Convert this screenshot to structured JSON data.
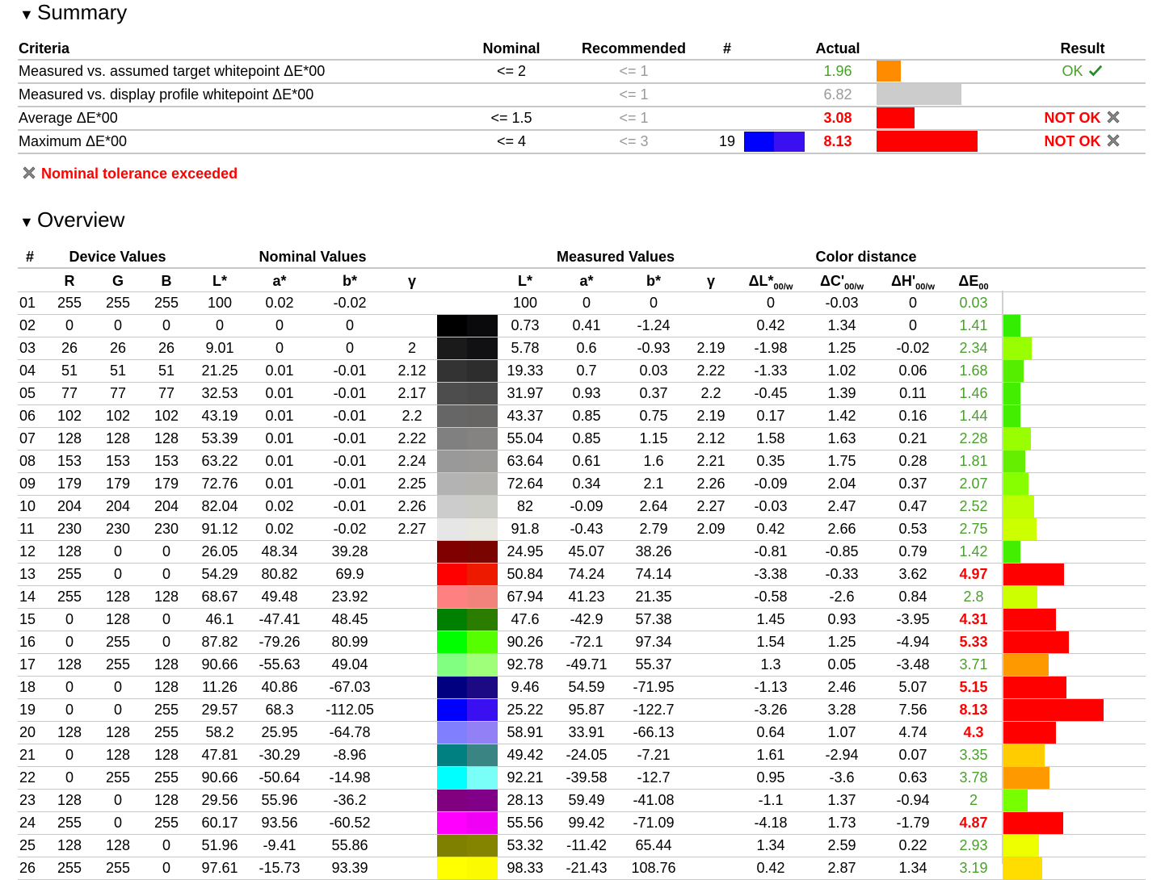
{
  "summary": {
    "heading": "Summary",
    "headers": {
      "criteria": "Criteria",
      "nominal": "Nominal",
      "recommended": "Recommended",
      "count": "#",
      "actual": "Actual",
      "result": "Result"
    },
    "rows": [
      {
        "criteria": "Measured vs. assumed target whitepoint ΔE*00",
        "nominal": "<= 2",
        "recommended": "<= 1",
        "count": "",
        "actual": "1.96",
        "actual_color": "#4aa02c",
        "actual_bold": false,
        "bar_color": "#ff8c00",
        "bar_value": 1.96,
        "result": "OK",
        "result_type": "ok"
      },
      {
        "criteria": "Measured vs. display profile whitepoint ΔE*00",
        "nominal": "",
        "recommended": "<= 1",
        "count": "",
        "actual": "6.82",
        "actual_color": "#9a9a9a",
        "actual_bold": false,
        "bar_color": "#cccccc",
        "bar_value": 6.82,
        "result": "",
        "result_type": "none"
      },
      {
        "criteria": "Average ΔE*00",
        "nominal": "<= 1.5",
        "recommended": "<= 1",
        "count": "",
        "actual": "3.08",
        "actual_color": "#ff0000",
        "actual_bold": true,
        "bar_color": "#ff0000",
        "bar_value": 3.08,
        "result": "NOT OK",
        "result_type": "fail"
      },
      {
        "criteria": "Maximum ΔE*00",
        "nominal": "<= 4",
        "recommended": "<= 3",
        "count": "19",
        "swatch": [
          "#0000ff",
          "#3a10f0"
        ],
        "actual": "8.13",
        "actual_color": "#ff0000",
        "actual_bold": true,
        "bar_color": "#ff0000",
        "bar_value": 8.13,
        "result": "NOT OK",
        "result_type": "fail"
      }
    ],
    "tolerance_note": "Nominal tolerance exceeded"
  },
  "overview": {
    "heading": "Overview",
    "groups": {
      "num": "#",
      "device": "Device Values",
      "nominal": "Nominal Values",
      "measured": "Measured Values",
      "distance": "Color distance"
    },
    "columns": {
      "r": "R",
      "g": "G",
      "b": "B",
      "L": "L*",
      "a": "a*",
      "bb": "b*",
      "gamma": "γ",
      "mL": "L*",
      "ma": "a*",
      "mb": "b*",
      "mgamma": "γ",
      "dL": "ΔL*",
      "dL_sub": "00/w",
      "dC": "ΔC'",
      "dC_sub": "00/w",
      "dH": "ΔH'",
      "dH_sub": "00/w",
      "dE": "ΔE",
      "dE_sub": "00"
    },
    "rows": [
      {
        "n": "01",
        "r": "255",
        "g": "255",
        "b": "255",
        "L": "100",
        "a": "0.02",
        "bb": "-0.02",
        "gm": "",
        "mL": "100",
        "ma": "0",
        "mb": "0",
        "mgm": "",
        "dL": "0",
        "dC": "-0.03",
        "dH": "0",
        "dE": "0.03",
        "sw": [
          "#ffffff",
          "#ffffff"
        ],
        "bar": "#33cc00"
      },
      {
        "n": "02",
        "r": "0",
        "g": "0",
        "b": "0",
        "L": "0",
        "a": "0",
        "bb": "0",
        "gm": "",
        "mL": "0.73",
        "ma": "0.41",
        "mb": "-1.24",
        "mgm": "",
        "dL": "0.42",
        "dC": "1.34",
        "dH": "0",
        "dE": "1.41",
        "sw": [
          "#000000",
          "#0a0a0c"
        ],
        "bar": "#33ee00"
      },
      {
        "n": "03",
        "r": "26",
        "g": "26",
        "b": "26",
        "L": "9.01",
        "a": "0",
        "bb": "0",
        "gm": "2",
        "mL": "5.78",
        "ma": "0.6",
        "mb": "-0.93",
        "mgm": "2.19",
        "dL": "-1.98",
        "dC": "1.25",
        "dH": "-0.02",
        "dE": "2.34",
        "sw": [
          "#1a1a1a",
          "#111113"
        ],
        "bar": "#99ff00"
      },
      {
        "n": "04",
        "r": "51",
        "g": "51",
        "b": "51",
        "L": "21.25",
        "a": "0.01",
        "bb": "-0.01",
        "gm": "2.12",
        "mL": "19.33",
        "ma": "0.7",
        "mb": "0.03",
        "mgm": "2.22",
        "dL": "-1.33",
        "dC": "1.02",
        "dH": "0.06",
        "dE": "1.68",
        "sw": [
          "#333333",
          "#2e2d2e"
        ],
        "bar": "#55ee00"
      },
      {
        "n": "05",
        "r": "77",
        "g": "77",
        "b": "77",
        "L": "32.53",
        "a": "0.01",
        "bb": "-0.01",
        "gm": "2.17",
        "mL": "31.97",
        "ma": "0.93",
        "mb": "0.37",
        "mgm": "2.2",
        "dL": "-0.45",
        "dC": "1.39",
        "dH": "0.11",
        "dE": "1.46",
        "sw": [
          "#4d4d4d",
          "#4b4a4a"
        ],
        "bar": "#44ee00"
      },
      {
        "n": "06",
        "r": "102",
        "g": "102",
        "b": "102",
        "L": "43.19",
        "a": "0.01",
        "bb": "-0.01",
        "gm": "2.2",
        "mL": "43.37",
        "ma": "0.85",
        "mb": "0.75",
        "mgm": "2.19",
        "dL": "0.17",
        "dC": "1.42",
        "dH": "0.16",
        "dE": "1.44",
        "sw": [
          "#666666",
          "#666564"
        ],
        "bar": "#44ee00"
      },
      {
        "n": "07",
        "r": "128",
        "g": "128",
        "b": "128",
        "L": "53.39",
        "a": "0.01",
        "bb": "-0.01",
        "gm": "2.22",
        "mL": "55.04",
        "ma": "0.85",
        "mb": "1.15",
        "mgm": "2.12",
        "dL": "1.58",
        "dC": "1.63",
        "dH": "0.21",
        "dE": "2.28",
        "sw": [
          "#808080",
          "#858382"
        ],
        "bar": "#99ff00"
      },
      {
        "n": "08",
        "r": "153",
        "g": "153",
        "b": "153",
        "L": "63.22",
        "a": "0.01",
        "bb": "-0.01",
        "gm": "2.24",
        "mL": "63.64",
        "ma": "0.61",
        "mb": "1.6",
        "mgm": "2.21",
        "dL": "0.35",
        "dC": "1.75",
        "dH": "0.28",
        "dE": "1.81",
        "sw": [
          "#999999",
          "#9b9a98"
        ],
        "bar": "#66ee00"
      },
      {
        "n": "09",
        "r": "179",
        "g": "179",
        "b": "179",
        "L": "72.76",
        "a": "0.01",
        "bb": "-0.01",
        "gm": "2.25",
        "mL": "72.64",
        "ma": "0.34",
        "mb": "2.1",
        "mgm": "2.26",
        "dL": "-0.09",
        "dC": "2.04",
        "dH": "0.37",
        "dE": "2.07",
        "sw": [
          "#b3b3b3",
          "#b4b3af"
        ],
        "bar": "#88ff00"
      },
      {
        "n": "10",
        "r": "204",
        "g": "204",
        "b": "204",
        "L": "82.04",
        "a": "0.02",
        "bb": "-0.01",
        "gm": "2.26",
        "mL": "82",
        "ma": "-0.09",
        "mb": "2.64",
        "mgm": "2.27",
        "dL": "-0.03",
        "dC": "2.47",
        "dH": "0.47",
        "dE": "2.52",
        "sw": [
          "#cccccc",
          "#cdcdc7"
        ],
        "bar": "#bbff00"
      },
      {
        "n": "11",
        "r": "230",
        "g": "230",
        "b": "230",
        "L": "91.12",
        "a": "0.02",
        "bb": "-0.02",
        "gm": "2.27",
        "mL": "91.8",
        "ma": "-0.43",
        "mb": "2.79",
        "mgm": "2.09",
        "dL": "0.42",
        "dC": "2.66",
        "dH": "0.53",
        "dE": "2.75",
        "sw": [
          "#e6e6e6",
          "#e8e8e1"
        ],
        "bar": "#ccff00"
      },
      {
        "n": "12",
        "r": "128",
        "g": "0",
        "b": "0",
        "L": "26.05",
        "a": "48.34",
        "bb": "39.28",
        "gm": "",
        "mL": "24.95",
        "ma": "45.07",
        "mb": "38.26",
        "mgm": "",
        "dL": "-0.81",
        "dC": "-0.85",
        "dH": "0.79",
        "dE": "1.42",
        "sw": [
          "#800000",
          "#7a0500"
        ],
        "bar": "#44ee00"
      },
      {
        "n": "13",
        "r": "255",
        "g": "0",
        "b": "0",
        "L": "54.29",
        "a": "80.82",
        "bb": "69.9",
        "gm": "",
        "mL": "50.84",
        "ma": "74.24",
        "mb": "74.14",
        "mgm": "",
        "dL": "-3.38",
        "dC": "-0.33",
        "dH": "3.62",
        "dE": "4.97",
        "sw": [
          "#ff0000",
          "#ee1a00"
        ],
        "bar": "#ff0000"
      },
      {
        "n": "14",
        "r": "255",
        "g": "128",
        "b": "128",
        "L": "68.67",
        "a": "49.48",
        "bb": "23.92",
        "gm": "",
        "mL": "67.94",
        "ma": "41.23",
        "mb": "21.35",
        "mgm": "",
        "dL": "-0.58",
        "dC": "-2.6",
        "dH": "0.84",
        "dE": "2.8",
        "sw": [
          "#ff8080",
          "#f2837c"
        ],
        "bar": "#ccff00"
      },
      {
        "n": "15",
        "r": "0",
        "g": "128",
        "b": "0",
        "L": "46.1",
        "a": "-47.41",
        "bb": "48.45",
        "gm": "",
        "mL": "47.6",
        "ma": "-42.9",
        "mb": "57.38",
        "mgm": "",
        "dL": "1.45",
        "dC": "0.93",
        "dH": "-3.95",
        "dE": "4.31",
        "sw": [
          "#008000",
          "#2b7d00"
        ],
        "bar": "#ff0000"
      },
      {
        "n": "16",
        "r": "0",
        "g": "255",
        "b": "0",
        "L": "87.82",
        "a": "-79.26",
        "bb": "80.99",
        "gm": "",
        "mL": "90.26",
        "ma": "-72.1",
        "mb": "97.34",
        "mgm": "",
        "dL": "1.54",
        "dC": "1.25",
        "dH": "-4.94",
        "dE": "5.33",
        "sw": [
          "#00ff00",
          "#55ff00"
        ],
        "bar": "#ff0000"
      },
      {
        "n": "17",
        "r": "128",
        "g": "255",
        "b": "128",
        "L": "90.66",
        "a": "-55.63",
        "bb": "49.04",
        "gm": "",
        "mL": "92.78",
        "ma": "-49.71",
        "mb": "55.37",
        "mgm": "",
        "dL": "1.3",
        "dC": "0.05",
        "dH": "-3.48",
        "dE": "3.71",
        "sw": [
          "#80ff80",
          "#a0ff7a"
        ],
        "bar": "#ff9900"
      },
      {
        "n": "18",
        "r": "0",
        "g": "0",
        "b": "128",
        "L": "11.26",
        "a": "40.86",
        "bb": "-67.03",
        "gm": "",
        "mL": "9.46",
        "ma": "54.59",
        "mb": "-71.95",
        "mgm": "",
        "dL": "-1.13",
        "dC": "2.46",
        "dH": "5.07",
        "dE": "5.15",
        "sw": [
          "#000080",
          "#1c0a84"
        ],
        "bar": "#ff0000"
      },
      {
        "n": "19",
        "r": "0",
        "g": "0",
        "b": "255",
        "L": "29.57",
        "a": "68.3",
        "bb": "-112.05",
        "gm": "",
        "mL": "25.22",
        "ma": "95.87",
        "mb": "-122.7",
        "mgm": "",
        "dL": "-3.26",
        "dC": "3.28",
        "dH": "7.56",
        "dE": "8.13",
        "sw": [
          "#0000ff",
          "#3a10f0"
        ],
        "bar": "#ff0000"
      },
      {
        "n": "20",
        "r": "128",
        "g": "128",
        "b": "255",
        "L": "58.2",
        "a": "25.95",
        "bb": "-64.78",
        "gm": "",
        "mL": "58.91",
        "ma": "33.91",
        "mb": "-66.13",
        "mgm": "",
        "dL": "0.64",
        "dC": "1.07",
        "dH": "4.74",
        "dE": "4.3",
        "sw": [
          "#8080ff",
          "#9280f6"
        ],
        "bar": "#ff0000"
      },
      {
        "n": "21",
        "r": "0",
        "g": "128",
        "b": "128",
        "L": "47.81",
        "a": "-30.29",
        "bb": "-8.96",
        "gm": "",
        "mL": "49.42",
        "ma": "-24.05",
        "mb": "-7.21",
        "mgm": "",
        "dL": "1.61",
        "dC": "-2.94",
        "dH": "0.07",
        "dE": "3.35",
        "sw": [
          "#008080",
          "#3a8584"
        ],
        "bar": "#ffcc00"
      },
      {
        "n": "22",
        "r": "0",
        "g": "255",
        "b": "255",
        "L": "90.66",
        "a": "-50.64",
        "bb": "-14.98",
        "gm": "",
        "mL": "92.21",
        "ma": "-39.58",
        "mb": "-12.7",
        "mgm": "",
        "dL": "0.95",
        "dC": "-3.6",
        "dH": "0.63",
        "dE": "3.78",
        "sw": [
          "#00ffff",
          "#7afff8"
        ],
        "bar": "#ff9900"
      },
      {
        "n": "23",
        "r": "128",
        "g": "0",
        "b": "128",
        "L": "29.56",
        "a": "55.96",
        "bb": "-36.2",
        "gm": "",
        "mL": "28.13",
        "ma": "59.49",
        "mb": "-41.08",
        "mgm": "",
        "dL": "-1.1",
        "dC": "1.37",
        "dH": "-0.94",
        "dE": "2",
        "sw": [
          "#800080",
          "#800088"
        ],
        "bar": "#77ff00"
      },
      {
        "n": "24",
        "r": "255",
        "g": "0",
        "b": "255",
        "L": "60.17",
        "a": "93.56",
        "bb": "-60.52",
        "gm": "",
        "mL": "55.56",
        "ma": "99.42",
        "mb": "-71.09",
        "mgm": "",
        "dL": "-4.18",
        "dC": "1.73",
        "dH": "-1.79",
        "dE": "4.87",
        "sw": [
          "#ff00ff",
          "#f000f4"
        ],
        "bar": "#ff0000"
      },
      {
        "n": "25",
        "r": "128",
        "g": "128",
        "b": "0",
        "L": "51.96",
        "a": "-9.41",
        "bb": "55.86",
        "gm": "",
        "mL": "53.32",
        "ma": "-11.42",
        "mb": "65.44",
        "mgm": "",
        "dL": "1.34",
        "dC": "2.59",
        "dH": "0.22",
        "dE": "2.93",
        "sw": [
          "#808000",
          "#848400"
        ],
        "bar": "#eeff00"
      },
      {
        "n": "26",
        "r": "255",
        "g": "255",
        "b": "0",
        "L": "97.61",
        "a": "-15.73",
        "bb": "93.39",
        "gm": "",
        "mL": "98.33",
        "ma": "-21.43",
        "mb": "108.76",
        "mgm": "",
        "dL": "0.42",
        "dC": "2.87",
        "dH": "1.34",
        "dE": "3.19",
        "sw": [
          "#ffff00",
          "#fbfa00"
        ],
        "bar": "#ffdd00"
      }
    ]
  }
}
